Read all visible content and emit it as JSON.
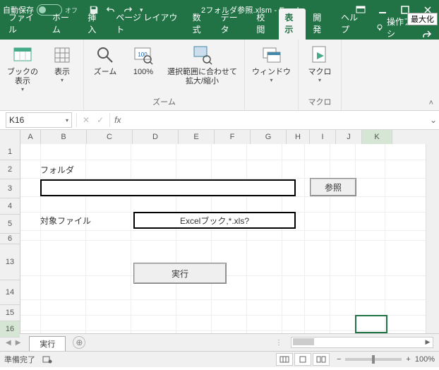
{
  "title_bar": {
    "autosave_label": "自動保存",
    "autosave_state": "オフ",
    "filename": "2フォルダ参照.xlsm - Excel",
    "tooltip": "最大化"
  },
  "tabs": {
    "file": "ファイル",
    "home": "ホーム",
    "insert": "挿入",
    "page_layout": "ページ レイアウト",
    "formulas": "数式",
    "data": "データ",
    "review": "校閲",
    "view": "表示",
    "developer": "開発",
    "help": "ヘルプ",
    "tell_me": "操作アシ"
  },
  "ribbon": {
    "book_view": "ブックの\n表示",
    "show": "表示",
    "zoom": "ズーム",
    "hundred": "100%",
    "fit_selection": "選択範囲に合わせて\n拡大/縮小",
    "window": "ウィンドウ",
    "macro": "マクロ",
    "group_zoom": "ズーム",
    "group_macro": "マクロ"
  },
  "namebox": "K16",
  "fx_label": "fx",
  "sheet": {
    "columns": [
      "A",
      "B",
      "C",
      "D",
      "E",
      "F",
      "G",
      "H",
      "I",
      "J",
      "K"
    ],
    "rows": [
      "1",
      "2",
      "3",
      "4",
      "5",
      "6",
      "13",
      "14",
      "15",
      "16"
    ],
    "folder_label": "フォルダ",
    "target_label": "対象ファイル",
    "target_value": "Excelブック,*.xls?",
    "browse_btn": "参照",
    "run_btn": "実行",
    "tab_name": "実行"
  },
  "status": {
    "ready": "準備完了",
    "zoom": "100%"
  }
}
